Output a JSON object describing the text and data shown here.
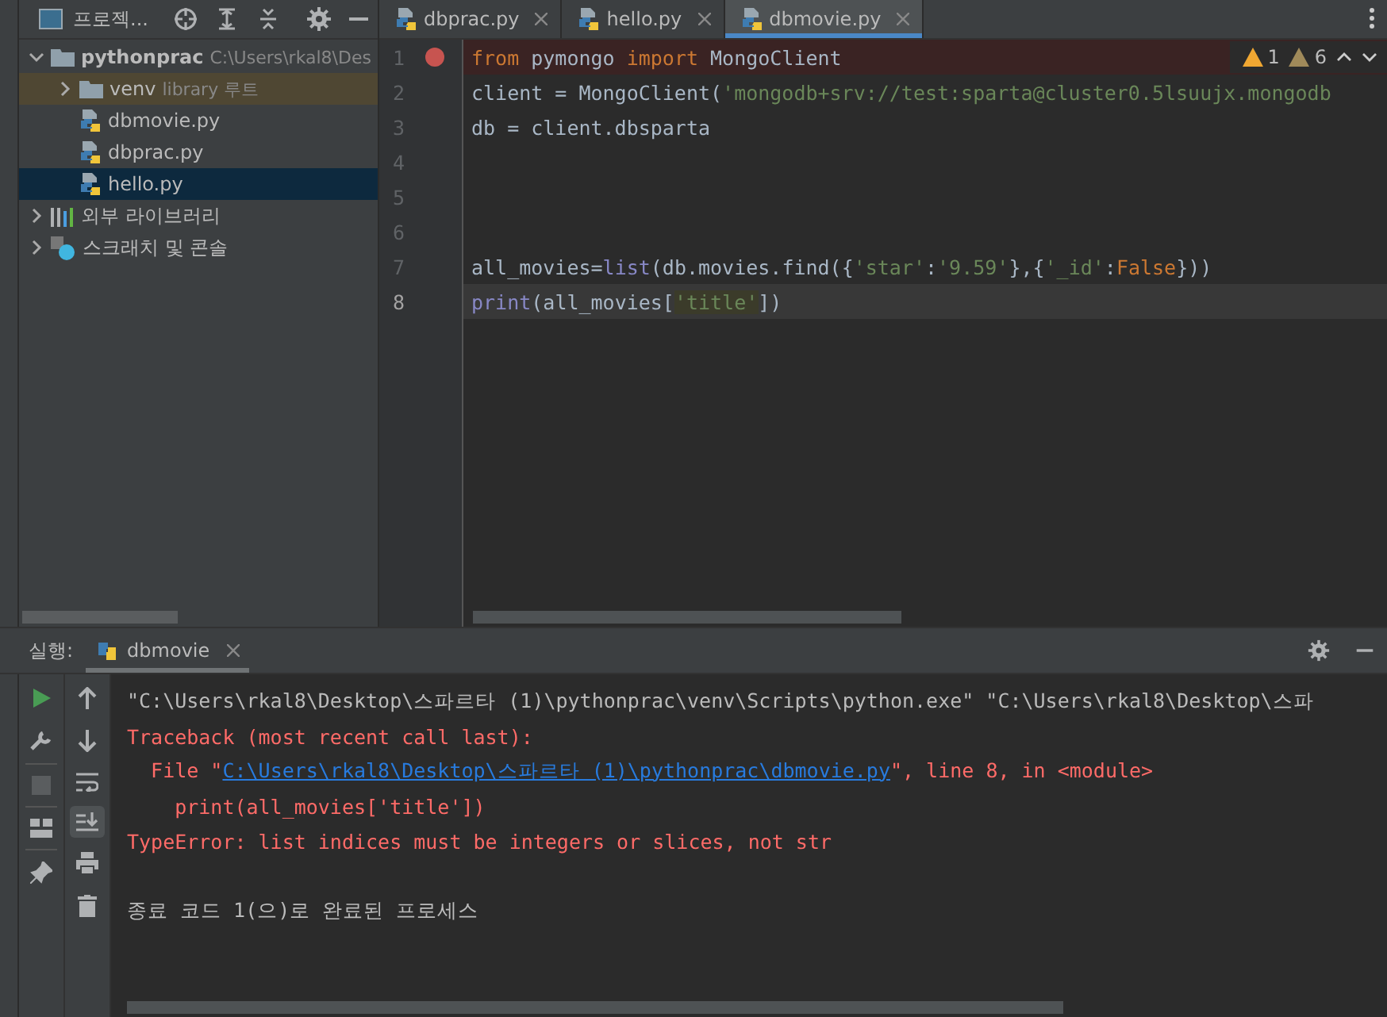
{
  "project_panel": {
    "title": "프로젝...",
    "tree": [
      {
        "name": "pythonprac",
        "kind": "folder",
        "note": "C:\\Users\\rkal8\\Des",
        "expanded": true,
        "selected": false,
        "children": [
          {
            "name": "venv",
            "kind": "folder",
            "note": "library 루트",
            "expanded": false,
            "selected": false,
            "excluded": true
          },
          {
            "name": "dbmovie.py",
            "kind": "python",
            "selected": false,
            "excluded": false
          },
          {
            "name": "dbprac.py",
            "kind": "python",
            "selected": false,
            "excluded": false
          },
          {
            "name": "hello.py",
            "kind": "python",
            "selected": true,
            "excluded": false
          }
        ]
      },
      {
        "name": "외부 라이브러리",
        "kind": "library",
        "expanded": false,
        "selected": false
      },
      {
        "name": "스크래치 및 콘솔",
        "kind": "scratch",
        "expanded": false,
        "selected": false
      }
    ]
  },
  "editor_tabs": [
    {
      "label": "dbprac.py",
      "selected": false
    },
    {
      "label": "hello.py",
      "selected": false
    },
    {
      "label": "dbmovie.py",
      "selected": true
    }
  ],
  "editor": {
    "warnings": [
      {
        "count": "1",
        "kind": "warning"
      },
      {
        "count": "6",
        "kind": "weak"
      }
    ],
    "lines": [
      {
        "number": "1",
        "breakpoint": true,
        "current": false,
        "tokens": [
          {
            "text": "from",
            "kind": "keyword"
          },
          {
            "text": " pymongo ",
            "kind": "plain"
          },
          {
            "text": "import",
            "kind": "keyword"
          },
          {
            "text": " MongoClient",
            "kind": "plain"
          }
        ]
      },
      {
        "number": "2",
        "breakpoint": false,
        "current": false,
        "tokens": [
          {
            "text": "client = MongoClient(",
            "kind": "plain"
          },
          {
            "text": "'mongodb+srv://test:sparta@cluster0.5lsuujx.mongodb",
            "kind": "string"
          }
        ]
      },
      {
        "number": "3",
        "breakpoint": false,
        "current": false,
        "tokens": [
          {
            "text": "db = client.dbsparta",
            "kind": "plain"
          }
        ]
      },
      {
        "number": "4",
        "breakpoint": false,
        "current": false
      },
      {
        "number": "5",
        "breakpoint": false,
        "current": false
      },
      {
        "number": "6",
        "breakpoint": false,
        "current": false
      },
      {
        "number": "7",
        "breakpoint": false,
        "current": false,
        "tokens": [
          {
            "text": "all_movies=",
            "kind": "plain"
          },
          {
            "text": "list",
            "kind": "builtin"
          },
          {
            "text": "(db.movies.find({",
            "kind": "plain"
          },
          {
            "text": "'star'",
            "kind": "string"
          },
          {
            "text": ":",
            "kind": "plain"
          },
          {
            "text": "'9.59'",
            "kind": "string"
          },
          {
            "text": "},",
            "kind": "plain"
          },
          {
            "text": "{",
            "kind": "plain"
          },
          {
            "text": "'_id'",
            "kind": "string"
          },
          {
            "text": ":",
            "kind": "plain"
          },
          {
            "text": "False",
            "kind": "keyword"
          },
          {
            "text": "}))",
            "kind": "plain"
          }
        ]
      },
      {
        "number": "8",
        "breakpoint": false,
        "current": true,
        "tokens": [
          {
            "text": "print",
            "kind": "builtin"
          },
          {
            "text": "(all_movies[",
            "kind": "plain"
          },
          {
            "text": "'title'",
            "kind": "highlight"
          },
          {
            "text": "])",
            "kind": "plain"
          }
        ]
      }
    ]
  },
  "run_panel": {
    "label": "실행:",
    "tab": "dbmovie",
    "console": [
      {
        "kind": "output",
        "tokens": [
          {
            "text": "\"C:\\Users\\rkal8\\Desktop\\스파르타 (1)\\pythonprac\\venv\\Scripts\\python.exe\" \"C:\\Users\\rkal8\\Desktop\\스파",
            "kind": "plain"
          }
        ]
      },
      {
        "kind": "output",
        "tokens": [
          {
            "text": "Traceback (most recent call last):",
            "kind": "error"
          }
        ]
      },
      {
        "kind": "output",
        "tokens": [
          {
            "text": "  File \"",
            "kind": "error"
          },
          {
            "text": "C:\\Users\\rkal8\\Desktop\\스파르타 (1)\\pythonprac\\dbmovie.py",
            "kind": "link"
          },
          {
            "text": "\", line 8, in <module>",
            "kind": "error"
          }
        ]
      },
      {
        "kind": "output",
        "tokens": [
          {
            "text": "    print(all_movies['title'])",
            "kind": "error"
          }
        ]
      },
      {
        "kind": "output",
        "tokens": [
          {
            "text": "TypeError: list indices must be integers or slices, not str",
            "kind": "error"
          }
        ]
      },
      {
        "kind": "exit",
        "tokens": [
          {
            "text": "종료 코드 1(으)로 완료된 프로세스",
            "kind": "plain"
          }
        ]
      }
    ]
  }
}
